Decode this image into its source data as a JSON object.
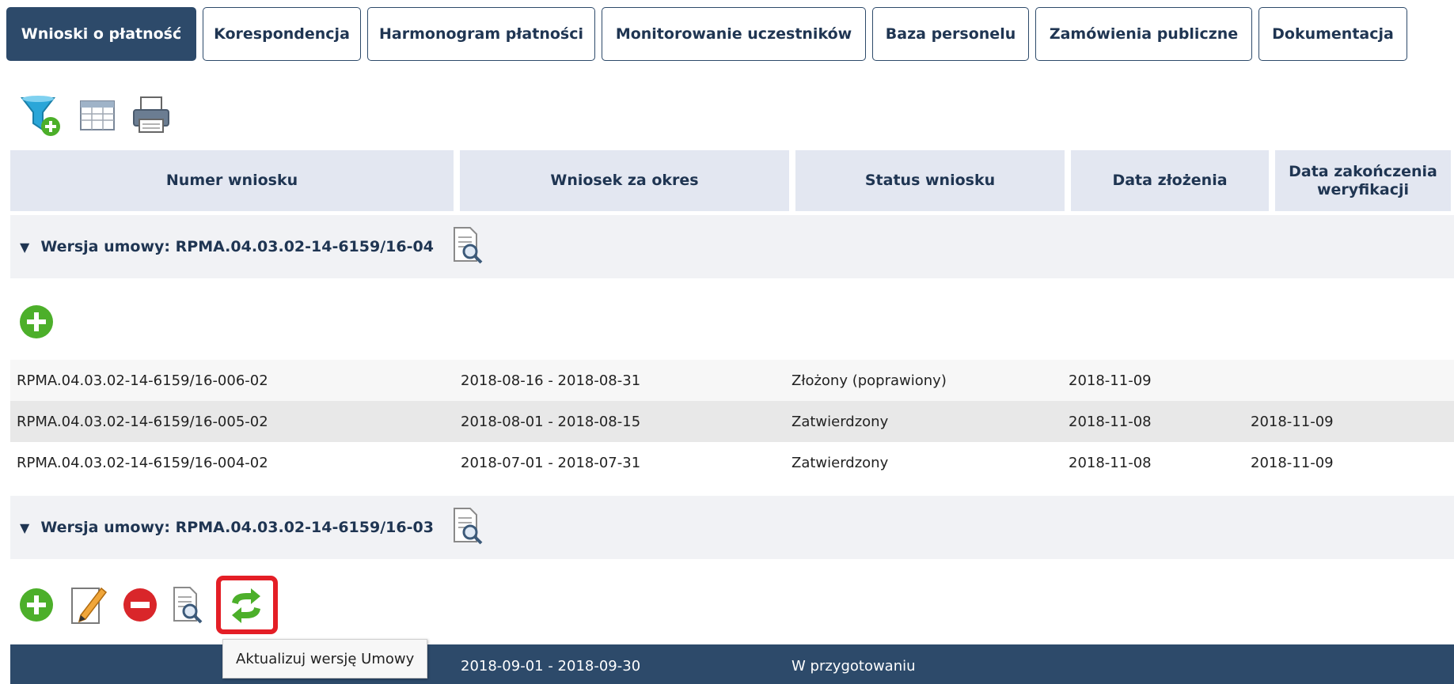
{
  "tabs": [
    {
      "label": "Wnioski o płatność",
      "active": true
    },
    {
      "label": "Korespondencja"
    },
    {
      "label": "Harmonogram płatności"
    },
    {
      "label": "Monitorowanie uczestników"
    },
    {
      "label": "Baza personelu"
    },
    {
      "label": "Zamówienia publiczne"
    },
    {
      "label": "Dokumentacja"
    }
  ],
  "toolbar": {
    "icons": [
      "filter-add-icon",
      "table-icon",
      "printer-icon"
    ]
  },
  "table": {
    "headers": [
      "Numer wniosku",
      "Wniosek za okres",
      "Status wniosku",
      "Data złożenia",
      "Data zakończenia weryfikacji"
    ]
  },
  "groups": [
    {
      "label": "Wersja umowy: RPMA.04.03.02-14-6159/16-04",
      "actions": [
        "add-icon"
      ],
      "rows": [
        {
          "number": "RPMA.04.03.02-14-6159/16-006-02",
          "period": "2018-08-16 - 2018-08-31",
          "status": "Złożony (poprawiony)",
          "submitted": "2018-11-09",
          "verified": ""
        },
        {
          "number": "RPMA.04.03.02-14-6159/16-005-02",
          "period": "2018-08-01 - 2018-08-15",
          "status": "Zatwierdzony",
          "submitted": "2018-11-08",
          "verified": "2018-11-09"
        },
        {
          "number": "RPMA.04.03.02-14-6159/16-004-02",
          "period": "2018-07-01 - 2018-07-31",
          "status": "Zatwierdzony",
          "submitted": "2018-11-08",
          "verified": "2018-11-09"
        }
      ]
    },
    {
      "label": "Wersja umowy: RPMA.04.03.02-14-6159/16-03",
      "actions": [
        "add-icon",
        "edit-icon",
        "delete-icon",
        "preview-icon",
        "refresh-icon"
      ],
      "rows": [
        {
          "number": "",
          "period": "2018-09-01 - 2018-09-30",
          "status": "W przygotowaniu",
          "submitted": "",
          "verified": ""
        }
      ]
    }
  ],
  "tooltip": {
    "text": "Aktualizuj wersję Umowy"
  },
  "colors": {
    "navy": "#2d4a6a",
    "header_bg": "#e3e7f1",
    "highlight": "#e41e26",
    "green": "#4caf2a",
    "red": "#d9262a"
  }
}
